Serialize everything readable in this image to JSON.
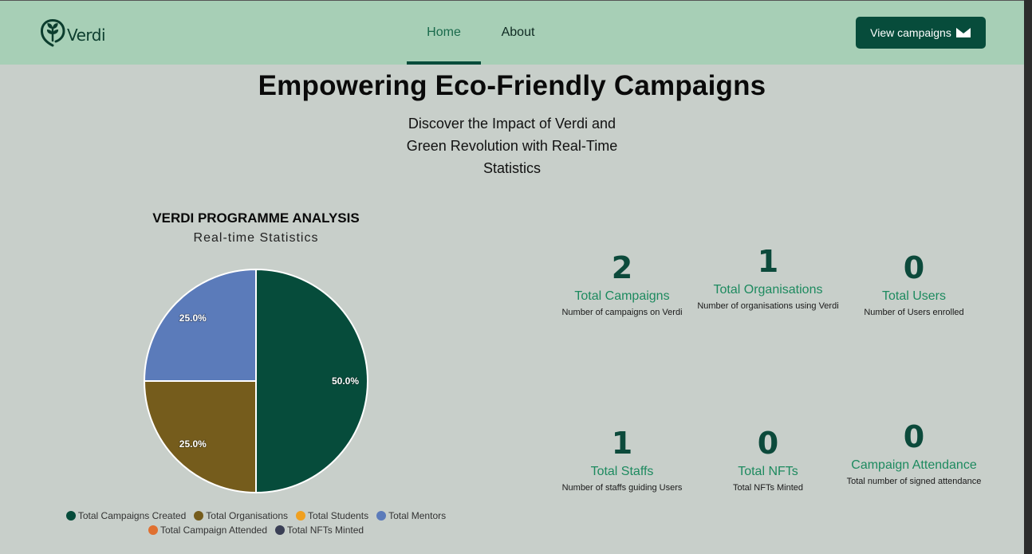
{
  "brand": {
    "name": "Verdi"
  },
  "nav": {
    "home": "Home",
    "about": "About"
  },
  "cta": {
    "label": "View campaigns"
  },
  "hero": {
    "title": "Empowering Eco-Friendly Campaigns",
    "subtitle_line1": "Discover the Impact of Verdi and",
    "subtitle_line2": "Green Revolution with Real-Time",
    "subtitle_line3": "Statistics"
  },
  "chart_section": {
    "title": "VERDI PROGRAMME ANALYSIS",
    "subtitle": "Real-time Statistics"
  },
  "chart_data": {
    "type": "pie",
    "title": "VERDI PROGRAMME ANALYSIS",
    "subtitle": "Real-time Statistics",
    "categories": [
      "Total Campaigns Created",
      "Total Organisations",
      "Total Students",
      "Total Mentors",
      "Total Campaign Attended",
      "Total NFTs Minted"
    ],
    "values": [
      2,
      1,
      0,
      1,
      0,
      0
    ],
    "percent_labels": [
      "50.0%",
      "25.0%",
      "",
      "25.0%",
      "",
      ""
    ],
    "colors": [
      "#064c3b",
      "#755c1c",
      "#f0a020",
      "#5b7bba",
      "#e07030",
      "#3a3f55"
    ],
    "legend_position": "bottom"
  },
  "stats": [
    {
      "value": "2",
      "label": "Total Campaigns",
      "desc": "Number of campaigns on Verdi"
    },
    {
      "value": "1",
      "label": "Total Organisations",
      "desc": "Number of organisations using Verdi"
    },
    {
      "value": "0",
      "label": "Total Users",
      "desc": "Number of Users enrolled"
    },
    {
      "value": "1",
      "label": "Total Staffs",
      "desc": "Number of staffs guiding Users"
    },
    {
      "value": "0",
      "label": "Total NFTs",
      "desc": "Total NFTs Minted"
    },
    {
      "value": "0",
      "label": "Campaign Attendance",
      "desc": "Total number of signed attendance"
    }
  ]
}
